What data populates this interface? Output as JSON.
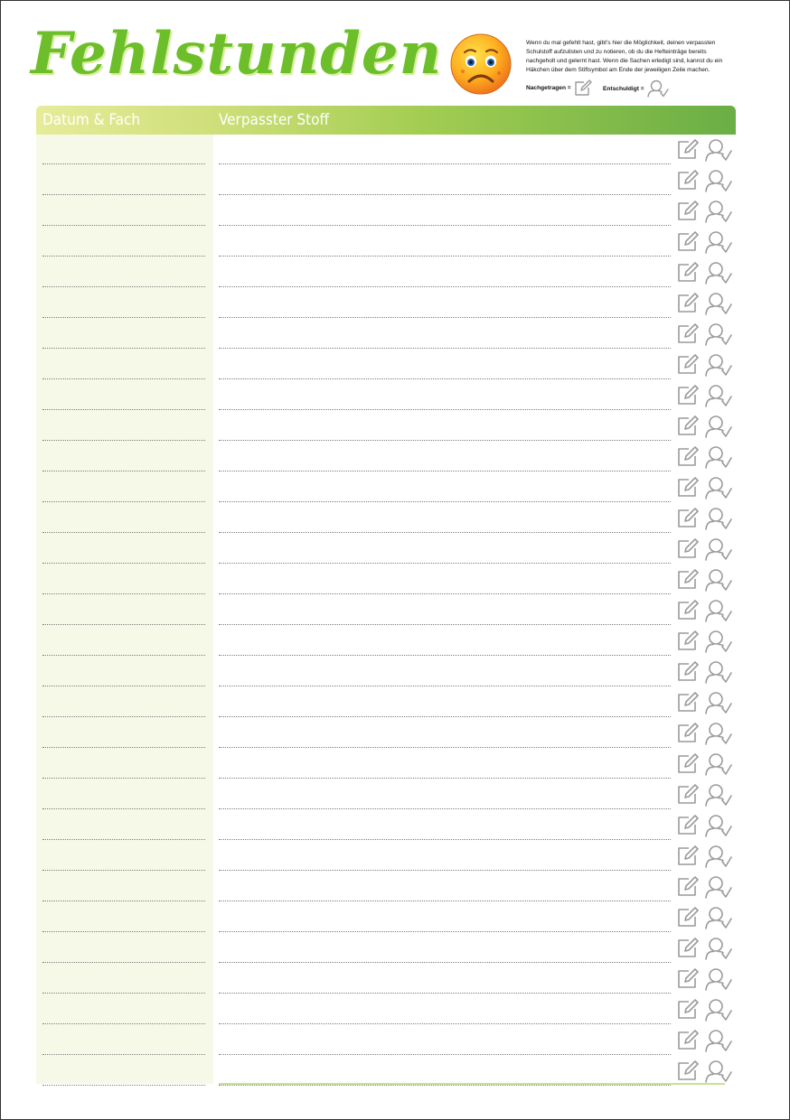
{
  "title": "Fehlstunden",
  "info": {
    "text": "Wenn du mal gefehlt hast, gibt’s hier die Möglichkeit, deinen verpassten Schulstoff aufzulisten und zu notieren, ob du die Hefteinträge bereits nachgeholt und gelernt hast. Wenn die Sachen erledigt sind, kannst du ein Häkchen über dem Stiftsymbol am Ende der jeweiligen Zeile machen.",
    "legend_nachgetragen": "Nachgetragen =",
    "legend_entschuldigt": "Entschuldigt ="
  },
  "columns": {
    "left": "Datum & Fach",
    "right": "Verpasster Stoff"
  },
  "icons": {
    "emoji": "sad-face-icon",
    "edit": "pencil-square-icon",
    "excused": "person-check-icon"
  },
  "colors": {
    "title": "#6cbf2a",
    "header_start": "#e6ec9a",
    "header_end": "#6aae45",
    "left_column_bg": "#f7f9e8",
    "icon_gray": "#9a9a9a"
  },
  "row_count": 31
}
